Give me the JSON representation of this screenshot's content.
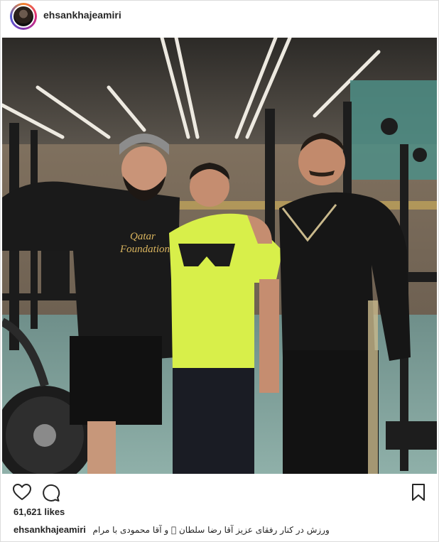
{
  "post": {
    "username": "ehsankhajeamiri",
    "likes_text": "61,621 likes",
    "caption_user": "ehsankhajeamiri",
    "caption_text": "ورزش در کنار رفقای عزیز آقا رضا سلطان 🏻 و آقا محمودی با مرام"
  },
  "photo": {
    "shirt_left_lines": [
      "Qatar",
      "Foundation"
    ]
  },
  "icons": {
    "like": "heart-icon",
    "comment": "comment-icon",
    "save": "bookmark-icon"
  }
}
